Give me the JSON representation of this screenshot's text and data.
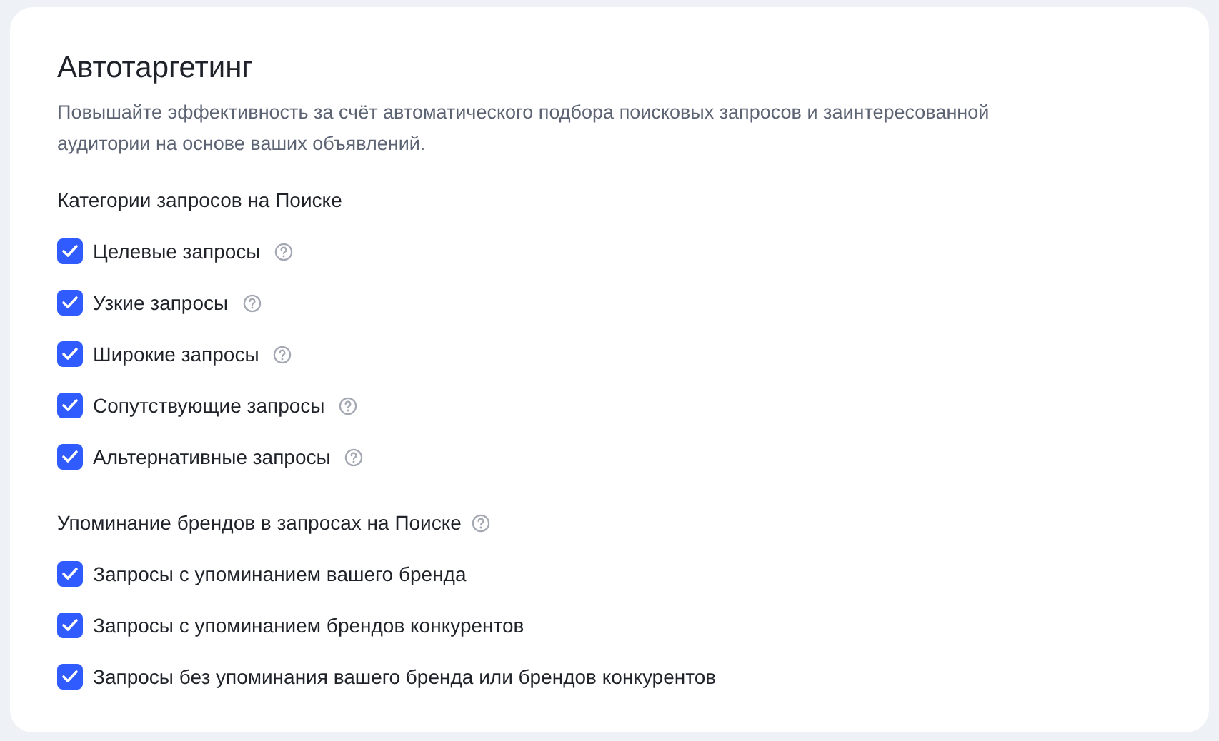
{
  "title": "Автотаргетинг",
  "description": "Повышайте эффективность за счёт автоматического подбора поисковых запросов и заинтересованной аудитории на основе ваших объявлений.",
  "sections": [
    {
      "heading": "Категории запросов на Поиске",
      "help": false,
      "options": [
        {
          "label": "Целевые запросы",
          "checked": true,
          "help": true
        },
        {
          "label": "Узкие запросы",
          "checked": true,
          "help": true
        },
        {
          "label": "Широкие запросы",
          "checked": true,
          "help": true
        },
        {
          "label": "Сопутствующие запросы",
          "checked": true,
          "help": true
        },
        {
          "label": "Альтернативные запросы",
          "checked": true,
          "help": true
        }
      ]
    },
    {
      "heading": "Упоминание брендов в запросах на Поиске",
      "help": true,
      "options": [
        {
          "label": "Запросы с упоминанием вашего бренда",
          "checked": true,
          "help": false
        },
        {
          "label": "Запросы с упоминанием брендов конкурентов",
          "checked": true,
          "help": false
        },
        {
          "label": "Запросы без упоминания вашего бренда или брендов конкурентов",
          "checked": true,
          "help": false
        }
      ]
    }
  ]
}
